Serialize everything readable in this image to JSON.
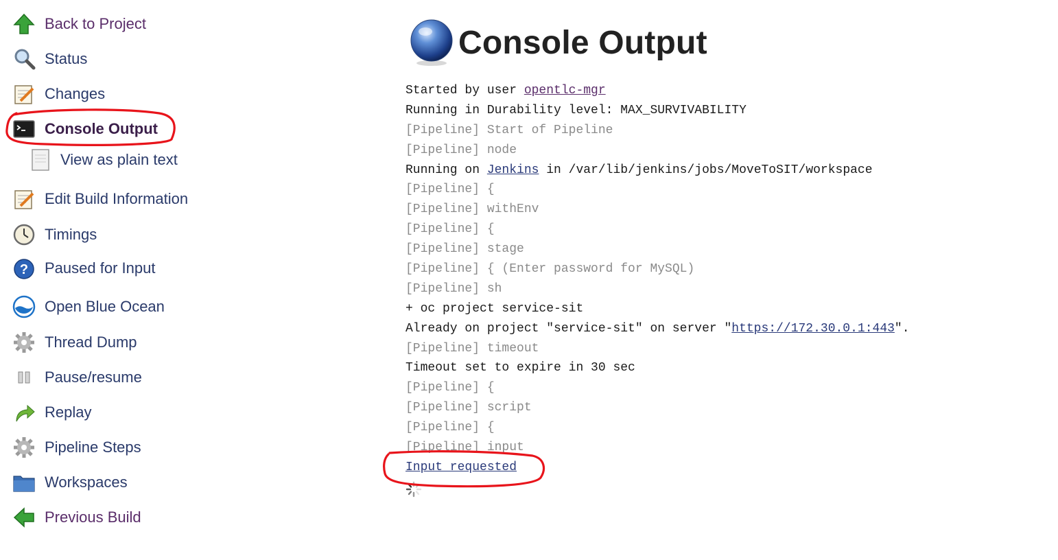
{
  "sidebar": {
    "items": [
      {
        "name": "sidebar-item-back-to-project",
        "label": "Back to Project"
      },
      {
        "name": "sidebar-item-status",
        "label": "Status"
      },
      {
        "name": "sidebar-item-changes",
        "label": "Changes"
      },
      {
        "name": "sidebar-item-console-output",
        "label": "Console Output"
      },
      {
        "name": "sidebar-item-view-as-plain-text",
        "label": "View as plain text"
      },
      {
        "name": "sidebar-item-edit-build-information",
        "label": "Edit Build Information"
      },
      {
        "name": "sidebar-item-timings",
        "label": "Timings"
      },
      {
        "name": "sidebar-item-paused-for-input",
        "label": "Paused for Input"
      },
      {
        "name": "sidebar-item-open-blue-ocean",
        "label": "Open Blue Ocean"
      },
      {
        "name": "sidebar-item-thread-dump",
        "label": "Thread Dump"
      },
      {
        "name": "sidebar-item-pause-resume",
        "label": "Pause/resume"
      },
      {
        "name": "sidebar-item-replay",
        "label": "Replay"
      },
      {
        "name": "sidebar-item-pipeline-steps",
        "label": "Pipeline Steps"
      },
      {
        "name": "sidebar-item-workspaces",
        "label": "Workspaces"
      },
      {
        "name": "sidebar-item-previous-build",
        "label": "Previous Build"
      }
    ]
  },
  "main": {
    "title": "Console Output",
    "console": {
      "line1_prefix": "Started by user ",
      "line1_user": "opentlc-mgr",
      "line2": "Running in Durability level: MAX_SURVIVABILITY",
      "line3": "[Pipeline] Start of Pipeline",
      "line4": "[Pipeline] node",
      "line5_prefix": "Running on ",
      "line5_node": "Jenkins",
      "line5_suffix": " in /var/lib/jenkins/jobs/MoveToSIT/workspace",
      "line6": "[Pipeline] {",
      "line7": "[Pipeline] withEnv",
      "line8": "[Pipeline] {",
      "line9": "[Pipeline] stage",
      "line10": "[Pipeline] { (Enter password for MySQL)",
      "line11": "[Pipeline] sh",
      "line12": "+ oc project service-sit",
      "line13_prefix": "Already on project \"service-sit\" on server \"",
      "line13_url": "https://172.30.0.1:443",
      "line13_suffix": "\".",
      "line14": "[Pipeline] timeout",
      "line15": "Timeout set to expire in 30 sec",
      "line16": "[Pipeline] {",
      "line17": "[Pipeline] script",
      "line18": "[Pipeline] {",
      "line19": "[Pipeline] input",
      "line20_link": "Input requested"
    }
  },
  "colors": {
    "link": "#2a3a7a",
    "visited_link": "#5a2d6a",
    "pipeline_text": "#8a8a8a",
    "annotation": "#e8141b"
  }
}
